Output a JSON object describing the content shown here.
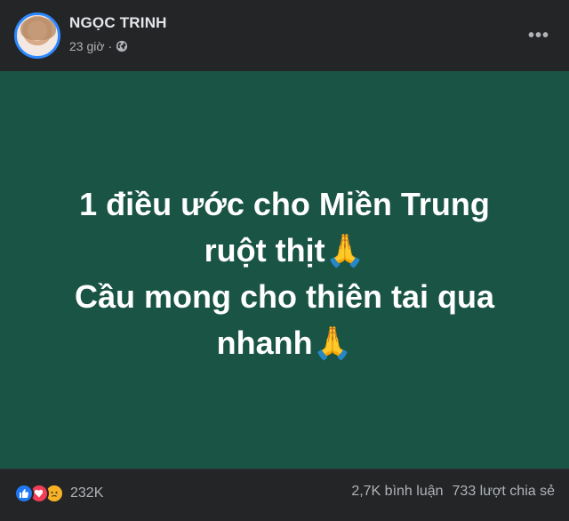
{
  "post": {
    "author_name": "NGỌC TRINH",
    "time": "23 giờ",
    "separator": "·",
    "privacy_icon": "globe-icon",
    "more_icon": "more-horizontal-icon",
    "more_label": "•••"
  },
  "status": {
    "background_color": "#1a5445",
    "lines": [
      "1 điều ước cho Miền Trung",
      "ruột thịt🙏",
      "Cầu mong cho thiên tai qua",
      "nhanh🙏"
    ]
  },
  "footer": {
    "reaction_icons": [
      "like-icon",
      "love-icon",
      "sad-icon"
    ],
    "reaction_count": "232K",
    "comments": "2,7K bình luận",
    "shares": "733 lượt chia sẻ"
  }
}
